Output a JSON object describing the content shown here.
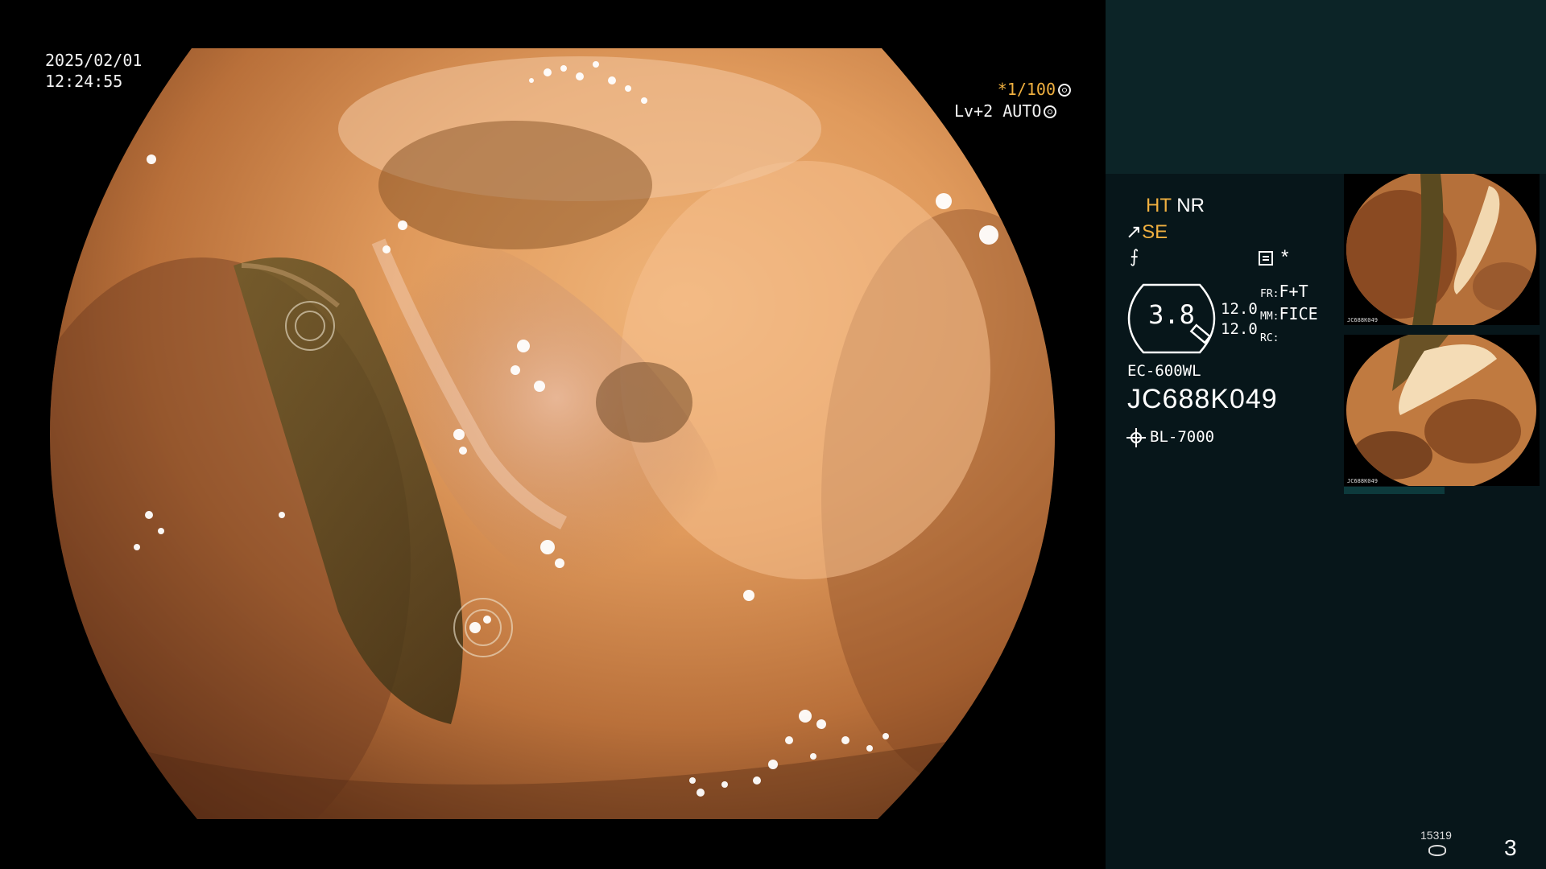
{
  "overlay": {
    "date": "2025/02/01",
    "time": "12:24:55",
    "shutter_speed": "*1/100",
    "exposure": "Lv+2 AUTO"
  },
  "panel": {
    "mode_ht": "HT",
    "mode_nr": "NR",
    "mode_se": "SE",
    "zoom": "3.8",
    "param_val_1": "12.0",
    "param_val_2": "12.0",
    "fr_key": "FR:",
    "fr_val": "F+T",
    "mm_key": "MM:",
    "mm_val": "FICE",
    "rc_key": "RC:",
    "scope_model": "EC-600WL",
    "scope_serial": "JC688K049",
    "light_source": "BL-7000",
    "frame_count": "15319",
    "page_number": "3"
  },
  "thumbnails": {
    "thumb_1_caption": "JC688K049",
    "thumb_2_caption": "JC688K049"
  },
  "colors": {
    "accent": "#f0b040",
    "panel_bg": "#07161a",
    "panel_header_bg": "#0c2427"
  }
}
